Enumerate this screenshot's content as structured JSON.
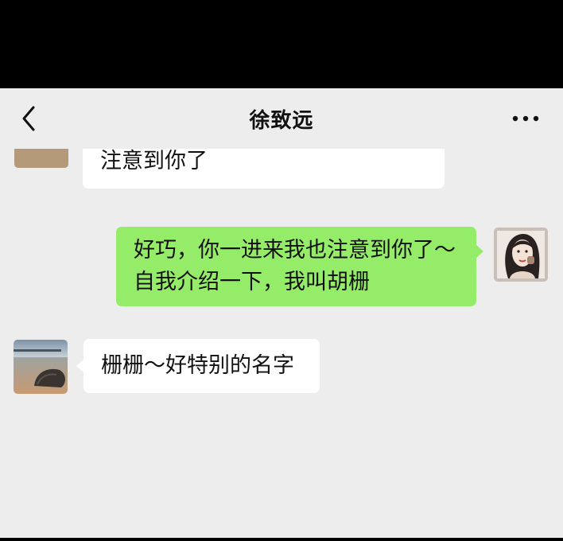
{
  "header": {
    "title": "徐致远",
    "back_icon": "chevron-left-icon",
    "more_icon": "more-dots-icon"
  },
  "messages": [
    {
      "side": "left",
      "text": "注意到你了",
      "partial": true
    },
    {
      "side": "right",
      "lines": [
        "好巧，你一进来我也注意到你了～",
        "自我介绍一下，我叫胡栅"
      ]
    },
    {
      "side": "left",
      "text": "栅栅～好特别的名字"
    }
  ],
  "colors": {
    "background": "#ededed",
    "sent_bubble": "#95ec69",
    "received_bubble": "#ffffff"
  }
}
